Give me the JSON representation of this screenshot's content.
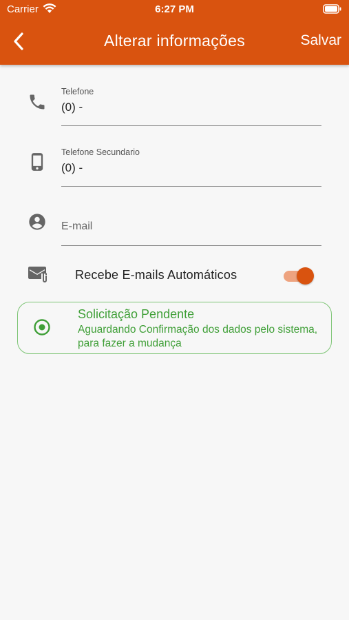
{
  "status_bar": {
    "carrier": "Carrier",
    "time": "6:27 PM"
  },
  "header": {
    "title": "Alterar informações",
    "save_label": "Salvar"
  },
  "fields": {
    "phone": {
      "label": "Telefone",
      "value": "(0) -"
    },
    "secondary_phone": {
      "label": "Telefone Secundario",
      "value": "(0) -"
    },
    "email": {
      "placeholder": "E-mail"
    }
  },
  "auto_emails": {
    "label": "Recebe E-mails Automáticos",
    "enabled": true
  },
  "pending_request": {
    "title": "Solicitação Pendente",
    "message": "Aguardando Confirmação dos dados pelo sistema, para fazer a mudança"
  },
  "colors": {
    "accent": "#d9530f",
    "success": "#3f9f37"
  },
  "icons": [
    "wifi-icon",
    "battery-icon",
    "back-arrow-icon",
    "phone-icon",
    "mobile-phone-icon",
    "account-circle-icon",
    "mail-attachment-icon",
    "radio-target-icon"
  ]
}
